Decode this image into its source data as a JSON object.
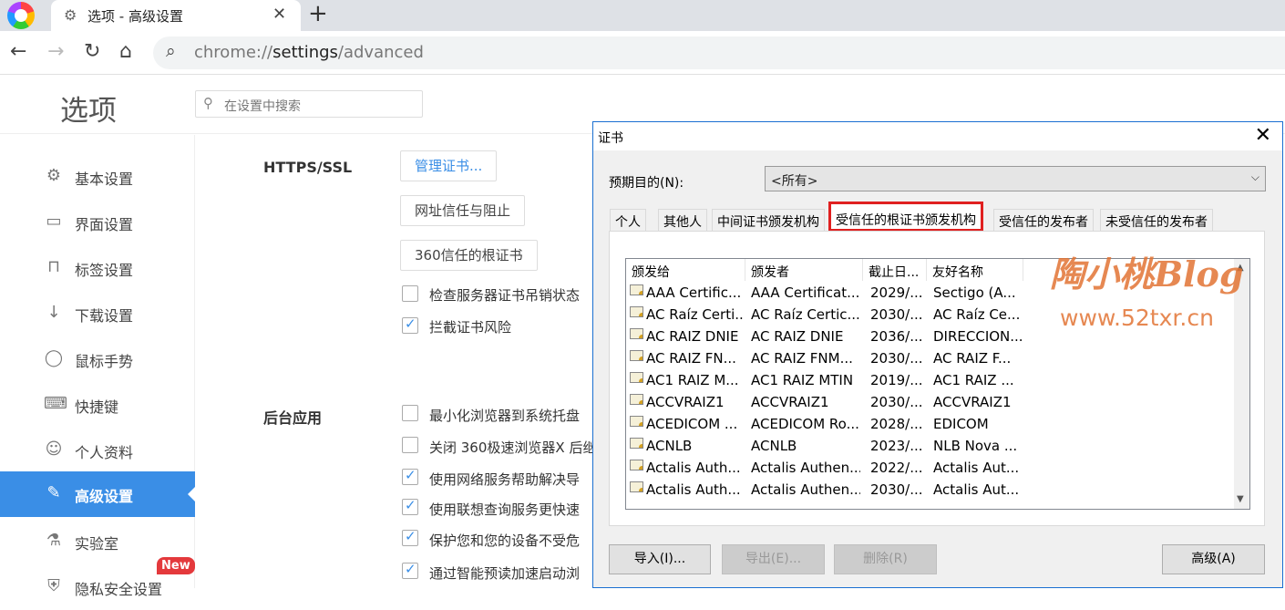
{
  "browser": {
    "tab_title": "选项 - 高级设置",
    "url_prefix": "chrome://",
    "url_host": "settings",
    "url_path": "/advanced"
  },
  "page": {
    "title": "选项",
    "search_placeholder": "在设置中搜索"
  },
  "sidebar": {
    "items": [
      {
        "label": "基本设置",
        "icon": "gear-icon"
      },
      {
        "label": "界面设置",
        "icon": "window-icon"
      },
      {
        "label": "标签设置",
        "icon": "tab-icon"
      },
      {
        "label": "下载设置",
        "icon": "download-icon"
      },
      {
        "label": "鼠标手势",
        "icon": "mouse-icon"
      },
      {
        "label": "快捷键",
        "icon": "keyboard-icon"
      },
      {
        "label": "个人资料",
        "icon": "person-icon"
      },
      {
        "label": "高级设置",
        "icon": "wrench-icon",
        "active": true
      },
      {
        "label": "实验室",
        "icon": "flask-icon"
      },
      {
        "label": "隐私安全设置",
        "icon": "shield-icon"
      }
    ],
    "new_badge": "New"
  },
  "https": {
    "heading": "HTTPS/SSL",
    "manage_certs": "管理证书...",
    "site_trust": "网址信任与阻止",
    "root_certs": "360信任的根证书",
    "check_revocation": "检查服务器证书吊销状态",
    "block_risk": "拦截证书风险"
  },
  "background": {
    "heading": "后台应用",
    "opt1": "最小化浏览器到系统托盘",
    "opt2": "关闭 360极速浏览器X 后继",
    "opt3": "使用网络服务帮助解决导",
    "opt4": "使用联想查询服务更快速",
    "opt5": "保护您和您的设备不受危",
    "opt6": "通过智能预读加速启动浏"
  },
  "dialog": {
    "title": "证书",
    "purpose_label": "预期目的(N):",
    "purpose_value": "<所有>",
    "tabs": [
      "个人",
      "其他人",
      "中间证书颁发机构",
      "受信任的根证书颁发机构",
      "受信任的发布者",
      "未受信任的发布者"
    ],
    "columns": [
      "颁发给",
      "颁发者",
      "截止日...",
      "友好名称"
    ],
    "rows": [
      [
        "AAA Certific...",
        "AAA Certificat...",
        "2029/...",
        "Sectigo (A..."
      ],
      [
        "AC Raíz Certi...",
        "AC Raíz Certic...",
        "2030/...",
        "AC Raíz Ce..."
      ],
      [
        "AC RAIZ DNIE",
        "AC RAIZ DNIE",
        "2036/...",
        "DIRECCION..."
      ],
      [
        "AC RAIZ FN...",
        "AC RAIZ FNM...",
        "2030/...",
        "AC RAIZ F..."
      ],
      [
        "AC1 RAIZ M...",
        "AC1 RAIZ MTIN",
        "2019/...",
        "AC1 RAIZ ..."
      ],
      [
        "ACCVRAIZ1",
        "ACCVRAIZ1",
        "2030/...",
        "ACCVRAIZ1"
      ],
      [
        "ACEDICOM ...",
        "ACEDICOM Ro...",
        "2028/...",
        "EDICOM"
      ],
      [
        "ACNLB",
        "ACNLB",
        "2023/...",
        "NLB Nova ..."
      ],
      [
        "Actalis Auth...",
        "Actalis Authen...",
        "2022/...",
        "Actalis Aut..."
      ],
      [
        "Actalis Auth...",
        "Actalis Authen...",
        "2030/...",
        "Actalis Aut..."
      ]
    ],
    "import_btn": "导入(I)...",
    "export_btn": "导出(E)...",
    "delete_btn": "删除(R)",
    "advanced_btn": "高级(A)"
  },
  "watermark": {
    "line1": "陶小桃Blog",
    "line2": "www.52txr.cn"
  }
}
